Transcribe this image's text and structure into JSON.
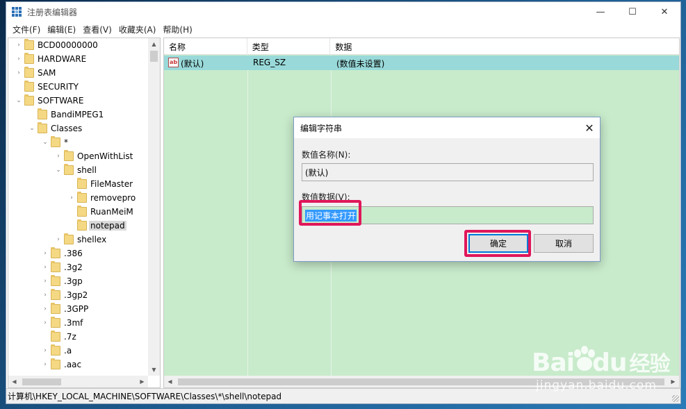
{
  "window": {
    "title": "注册表编辑器",
    "controls": {
      "minimize": "—",
      "maximize": "☐",
      "close": "✕"
    }
  },
  "menu": [
    "文件(F)",
    "编辑(E)",
    "查看(V)",
    "收藏夹(A)",
    "帮助(H)"
  ],
  "tree": [
    {
      "label": "BCD00000000",
      "expander": "›"
    },
    {
      "label": "HARDWARE",
      "expander": "›"
    },
    {
      "label": "SAM",
      "expander": "›"
    },
    {
      "label": "SECURITY",
      "expander": ""
    },
    {
      "label": "SOFTWARE",
      "expander": "⌄"
    },
    {
      "label": "BandiMPEG1",
      "expander": ""
    },
    {
      "label": "Classes",
      "expander": "⌄"
    },
    {
      "label": "*",
      "expander": "⌄"
    },
    {
      "label": "OpenWithList",
      "expander": "›"
    },
    {
      "label": "shell",
      "expander": "⌄"
    },
    {
      "label": "FileMaster",
      "expander": ""
    },
    {
      "label": "removepro",
      "expander": "›"
    },
    {
      "label": "RuanMeiM",
      "expander": ""
    },
    {
      "label": "notepad",
      "expander": "",
      "selected": true
    },
    {
      "label": "shellex",
      "expander": "›"
    },
    {
      "label": ".386",
      "expander": "›"
    },
    {
      "label": ".3g2",
      "expander": "›"
    },
    {
      "label": ".3gp",
      "expander": "›"
    },
    {
      "label": ".3gp2",
      "expander": "›"
    },
    {
      "label": ".3GPP",
      "expander": "›"
    },
    {
      "label": ".3mf",
      "expander": "›"
    },
    {
      "label": ".7z",
      "expander": ""
    },
    {
      "label": ".a",
      "expander": "›"
    },
    {
      "label": ".aac",
      "expander": "›"
    }
  ],
  "list": {
    "columns": [
      "名称",
      "类型",
      "数据"
    ],
    "rows": [
      {
        "icon": "ab",
        "name": "(默认)",
        "type": "REG_SZ",
        "data": "(数值未设置)"
      }
    ]
  },
  "statusbar": {
    "path": "计算机\\HKEY_LOCAL_MACHINE\\SOFTWARE\\Classes\\*\\shell\\notepad"
  },
  "dialog": {
    "title": "编辑字符串",
    "close": "✕",
    "name_label": "数值名称(N):",
    "name_value": "(默认)",
    "data_label": "数值数据(V):",
    "data_value": "用记事本打开",
    "ok_label": "确定",
    "cancel_label": "取消"
  },
  "colors": {
    "list_background": "#c8ebcb",
    "selected_row": "#99d9d9",
    "highlight_frame": "#e0175a"
  },
  "watermark": {
    "logo_left": "Bai",
    "logo_right": "du",
    "logo_cn": "经验",
    "url": "jingyan.baidu.com"
  }
}
